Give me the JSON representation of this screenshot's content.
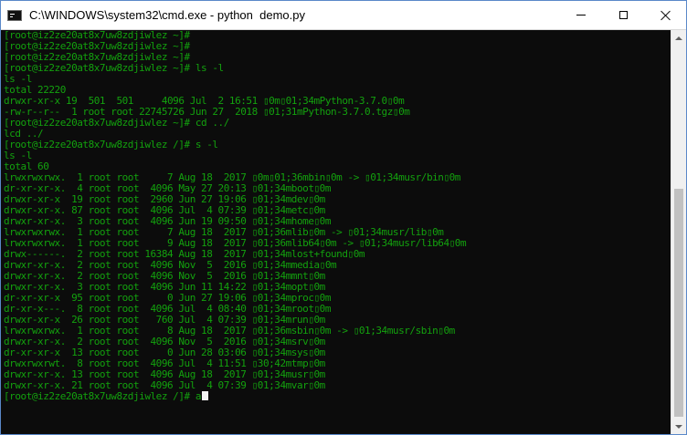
{
  "window": {
    "title": "C:\\WINDOWS\\system32\\cmd.exe - python  demo.py"
  },
  "terminal": {
    "lines": [
      "[root@iz2ze20at8x7uw8zdjiwlez ~]#",
      "[root@iz2ze20at8x7uw8zdjiwlez ~]#",
      "[root@iz2ze20at8x7uw8zdjiwlez ~]#",
      "[root@iz2ze20at8x7uw8zdjiwlez ~]# ls -l",
      "ls -l",
      "total 22220",
      "drwxr-xr-x 19  501  501     4096 Jul  2 16:51 ▯0m▯01;34mPython-3.7.0▯0m",
      "-rw-r--r--  1 root root 22745726 Jun 27  2018 ▯01;31mPython-3.7.0.tgz▯0m",
      "[root@iz2ze20at8x7uw8zdjiwlez ~]# cd ../",
      "lcd ../",
      "[root@iz2ze20at8x7uw8zdjiwlez /]# s -l",
      "ls -l",
      "total 60",
      "lrwxrwxrwx.  1 root root     7 Aug 18  2017 ▯0m▯01;36mbin▯0m -> ▯01;34musr/bin▯0m",
      "dr-xr-xr-x.  4 root root  4096 May 27 20:13 ▯01;34mboot▯0m",
      "drwxr-xr-x  19 root root  2960 Jun 27 19:06 ▯01;34mdev▯0m",
      "drwxr-xr-x. 87 root root  4096 Jul  4 07:39 ▯01;34metc▯0m",
      "drwxr-xr-x.  3 root root  4096 Jun 19 09:50 ▯01;34mhome▯0m",
      "lrwxrwxrwx.  1 root root     7 Aug 18  2017 ▯01;36mlib▯0m -> ▯01;34musr/lib▯0m",
      "lrwxrwxrwx.  1 root root     9 Aug 18  2017 ▯01;36mlib64▯0m -> ▯01;34musr/lib64▯0m",
      "drwx------.  2 root root 16384 Aug 18  2017 ▯01;34mlost+found▯0m",
      "drwxr-xr-x.  2 root root  4096 Nov  5  2016 ▯01;34mmedia▯0m",
      "drwxr-xr-x.  2 root root  4096 Nov  5  2016 ▯01;34mmnt▯0m",
      "drwxr-xr-x.  3 root root  4096 Jun 11 14:22 ▯01;34mopt▯0m",
      "dr-xr-xr-x  95 root root     0 Jun 27 19:06 ▯01;34mproc▯0m",
      "dr-xr-x---.  8 root root  4096 Jul  4 08:40 ▯01;34mroot▯0m",
      "drwxr-xr-x  26 root root   760 Jul  4 07:39 ▯01;34mrun▯0m",
      "lrwxrwxrwx.  1 root root     8 Aug 18  2017 ▯01;36msbin▯0m -> ▯01;34musr/sbin▯0m",
      "drwxr-xr-x.  2 root root  4096 Nov  5  2016 ▯01;34msrv▯0m",
      "dr-xr-xr-x  13 root root     0 Jun 28 03:06 ▯01;34msys▯0m",
      "drwxrwxrwt.  8 root root  4096 Jul  4 11:51 ▯30;42mtmp▯0m",
      "drwxr-xr-x. 13 root root  4096 Aug 18  2017 ▯01;34musr▯0m",
      "drwxr-xr-x. 21 root root  4096 Jul  4 07:39 ▯01;34mvar▯0m",
      "[root@iz2ze20at8x7uw8zdjiwlez /]# a"
    ]
  },
  "icons": {
    "app": "cmd-app-icon",
    "minimize": "minimize-icon",
    "maximize": "maximize-icon",
    "close": "close-icon"
  },
  "colors": {
    "console_text": "#13a10e",
    "console_bg": "#0c0c0c",
    "cursor": "#f2f2f2"
  }
}
